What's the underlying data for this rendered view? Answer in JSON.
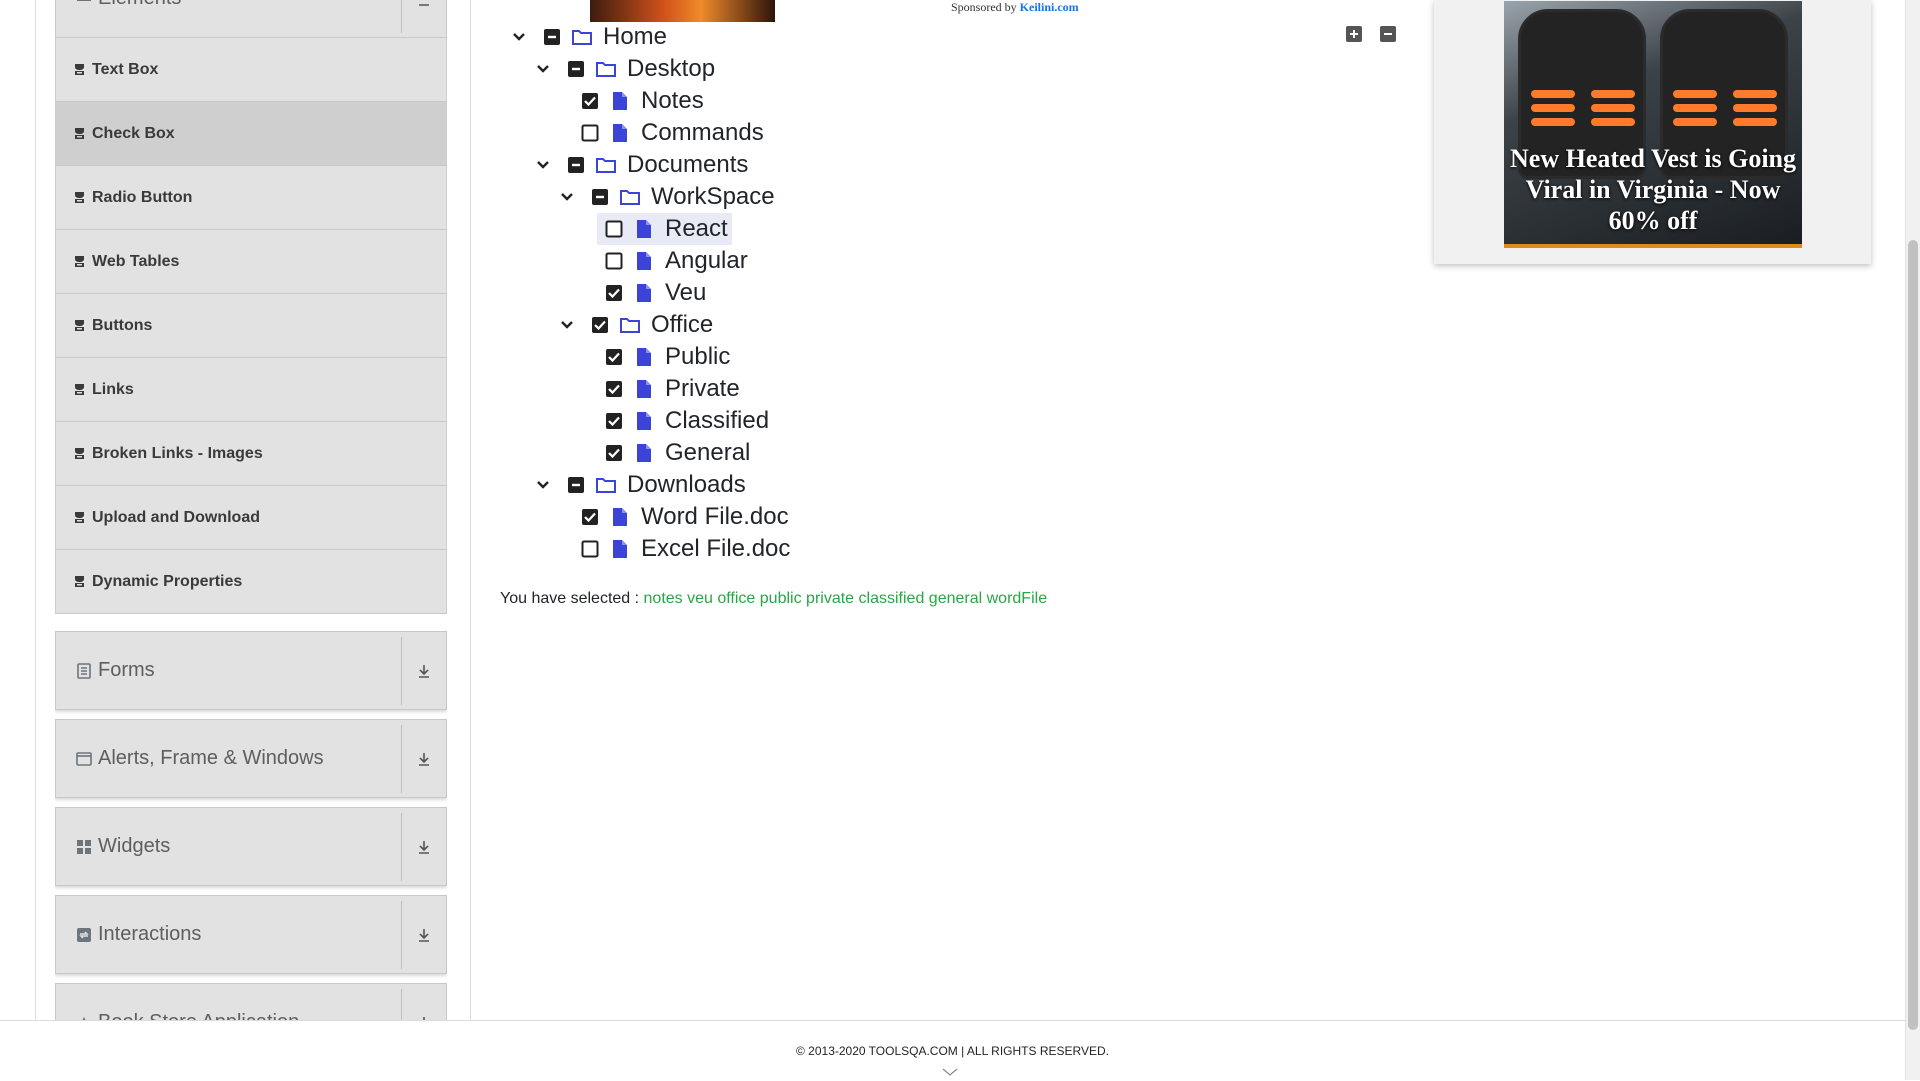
{
  "sidebar": {
    "elements_title": "Elements",
    "items": [
      {
        "label": "Text Box"
      },
      {
        "label": "Check Box"
      },
      {
        "label": "Radio Button"
      },
      {
        "label": "Web Tables"
      },
      {
        "label": "Buttons"
      },
      {
        "label": "Links"
      },
      {
        "label": "Broken Links - Images"
      },
      {
        "label": "Upload and Download"
      },
      {
        "label": "Dynamic Properties"
      }
    ],
    "groups": [
      {
        "title": "Forms",
        "icon": "form-icon"
      },
      {
        "title": "Alerts, Frame & Windows",
        "icon": "window-icon"
      },
      {
        "title": "Widgets",
        "icon": "widgets-icon"
      },
      {
        "title": "Interactions",
        "icon": "interactions-icon"
      },
      {
        "title": "Book Store Application",
        "icon": "book-store-icon"
      }
    ]
  },
  "sponsored": {
    "prefix": "Sponsored by",
    "brand": "Keilini.com"
  },
  "tree": {
    "nodes": [
      {
        "label": "Home",
        "type": "folder",
        "state": "partial"
      },
      {
        "label": "Desktop",
        "type": "folder",
        "state": "partial"
      },
      {
        "label": "Notes",
        "type": "file",
        "state": "checked"
      },
      {
        "label": "Commands",
        "type": "file",
        "state": "unchecked"
      },
      {
        "label": "Documents",
        "type": "folder",
        "state": "partial"
      },
      {
        "label": "WorkSpace",
        "type": "folder",
        "state": "partial"
      },
      {
        "label": "React",
        "type": "file",
        "state": "unchecked"
      },
      {
        "label": "Angular",
        "type": "file",
        "state": "unchecked"
      },
      {
        "label": "Veu",
        "type": "file",
        "state": "checked"
      },
      {
        "label": "Office",
        "type": "folder",
        "state": "checked"
      },
      {
        "label": "Public",
        "type": "file",
        "state": "checked"
      },
      {
        "label": "Private",
        "type": "file",
        "state": "checked"
      },
      {
        "label": "Classified",
        "type": "file",
        "state": "checked"
      },
      {
        "label": "General",
        "type": "file",
        "state": "checked"
      },
      {
        "label": "Downloads",
        "type": "folder",
        "state": "partial"
      },
      {
        "label": "Word File.doc",
        "type": "file",
        "state": "checked"
      },
      {
        "label": "Excel File.doc",
        "type": "file",
        "state": "unchecked"
      }
    ]
  },
  "result": {
    "prefix": "You have selected :",
    "selected": [
      "notes",
      "veu",
      "office",
      "public",
      "private",
      "classified",
      "general",
      "wordFile"
    ]
  },
  "ad": {
    "text": "New Heated Vest is Going Viral in Virginia - Now 60% off"
  },
  "footer": {
    "text": "© 2013-2020 TOOLSQA.COM | ALL RIGHTS RESERVED."
  },
  "colors": {
    "folder_icon": "#3b44d6",
    "file_icon": "#3b44d6",
    "selected_text": "#28a745",
    "sidebar_bg": "#e2e2e2"
  }
}
